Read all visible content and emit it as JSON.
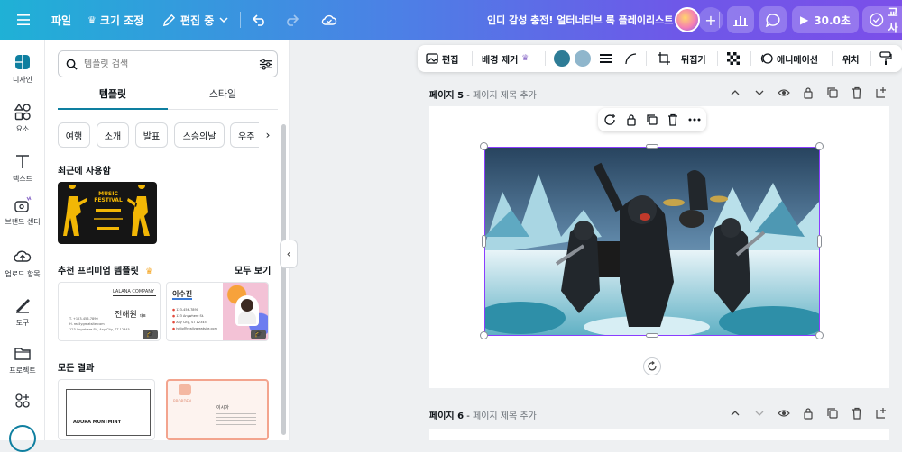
{
  "topbar": {
    "menu_icon": "hamburger-icon",
    "file_label": "파일",
    "resize_label": "크기 조정",
    "editing_label": "편집 중",
    "title": "인디 감성 충전! 얼터너티브 록 플레이리스트",
    "play_label": "30.0초",
    "share_label": "교사",
    "colors": {
      "gradient_start": "#1fb1d6",
      "gradient_end": "#7b4fe9"
    }
  },
  "rail": {
    "items": [
      {
        "label": "디자인",
        "icon": "design-icon"
      },
      {
        "label": "요소",
        "icon": "elements-icon"
      },
      {
        "label": "텍스트",
        "icon": "text-icon"
      },
      {
        "label": "브랜드 센터",
        "icon": "brand-icon"
      },
      {
        "label": "업로드 항목",
        "icon": "upload-icon"
      },
      {
        "label": "도구",
        "icon": "tools-icon"
      },
      {
        "label": "프로젝트",
        "icon": "folder-icon"
      },
      {
        "label": "",
        "icon": "apps-icon"
      }
    ]
  },
  "panel": {
    "search_placeholder": "템플릿 검색",
    "tabs": [
      "템플릿",
      "스타일"
    ],
    "chips": [
      "여행",
      "소개",
      "발표",
      "스승의날",
      "우주"
    ],
    "recent_title": "최근에 사용함",
    "recent_card": {
      "line1": "MUSIC",
      "line2": "FESTIVAL"
    },
    "premium_title": "추천 프리미엄 템플릿",
    "see_all": "모두 보기",
    "card1": {
      "company": "LALANA COMPANY",
      "name": "전해원",
      "role": "대표",
      "phone": "T. +123-456-7890",
      "email": "H. reallygreatsite.com",
      "address": "123 Anywhere St., Any City, ST 12345"
    },
    "card2": {
      "name": "이수진",
      "phone": "123-456-7890",
      "address": "123 Anywhere St.",
      "city": "Any City, ST 12345",
      "email": "hello@reallygreatsite.com"
    },
    "all_results_title": "모든 결과",
    "card3": {
      "name": "ADORA MONTMINY"
    },
    "card4": {
      "name": "이시아",
      "brand": "BRORDEN"
    }
  },
  "context_toolbar": {
    "edit_label": "편집",
    "bg_remove_label": "배경 제거",
    "flip_label": "뒤집기",
    "animate_label": "애니메이션",
    "position_label": "위치",
    "color1": "#2e7c96",
    "color2": "#8fb6cc"
  },
  "pages": [
    {
      "number": "페이지 5",
      "sep": " - ",
      "title": "페이지 제목 추가"
    },
    {
      "number": "페이지 6",
      "sep": " - ",
      "title": "페이지 제목 추가"
    }
  ]
}
